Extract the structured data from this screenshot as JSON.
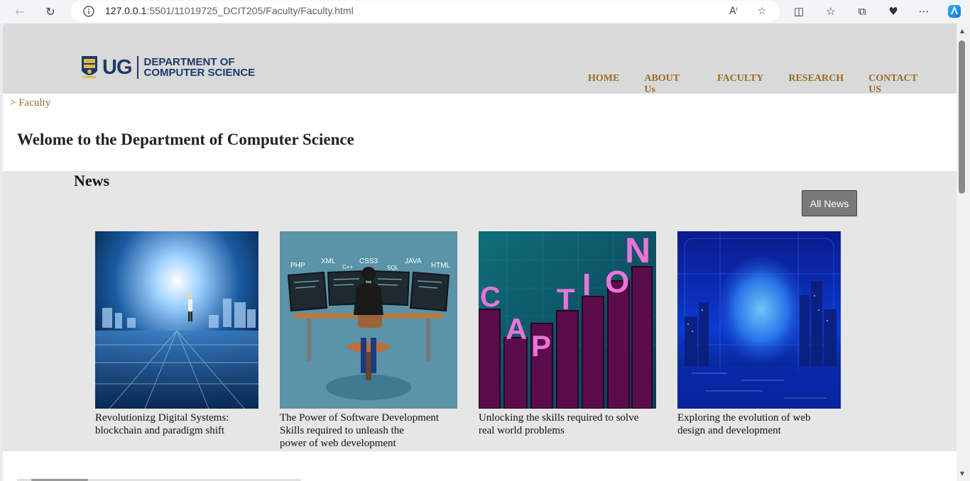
{
  "browser": {
    "url_host": "127.0.0.1",
    "url_rest": ":5501/11019725_DCIT205/Faculty/Faculty.html"
  },
  "header": {
    "logo_ug": "UG",
    "logo_line1": "DEPARTMENT OF",
    "logo_line2": "COMPUTER SCIENCE",
    "nav": [
      "HOME",
      "ABOUT Us",
      "FACULTY",
      "RESEARCH",
      "CONTACT US"
    ]
  },
  "breadcrumb": "> Faculty",
  "welcome": "Welome to the Department of Computer Science",
  "news": {
    "title": "News",
    "all_news_label": "All News",
    "items": [
      {
        "caption_line1": "Revolutionizg Digital Systems:",
        "caption_line2": "blockchain and paradigm shift",
        "caption_line3": ""
      },
      {
        "caption_line1": "The Power of Software Development",
        "caption_line2": "Skills required to unleash the",
        "caption_line3": "power of web development"
      },
      {
        "caption_line1": "Unlocking the skills required to solve",
        "caption_line2": "real world problems",
        "caption_line3": ""
      },
      {
        "caption_line1": "Exploring the evolution of web",
        "caption_line2": "design and development",
        "caption_line3": ""
      }
    ],
    "image2_labels": [
      "PHP",
      "XML",
      "C++",
      "CSS3",
      "SQL",
      "JAVA",
      "HTML"
    ],
    "image3_letters": [
      "C",
      "A",
      "P",
      "T",
      "I",
      "O",
      "N"
    ]
  }
}
